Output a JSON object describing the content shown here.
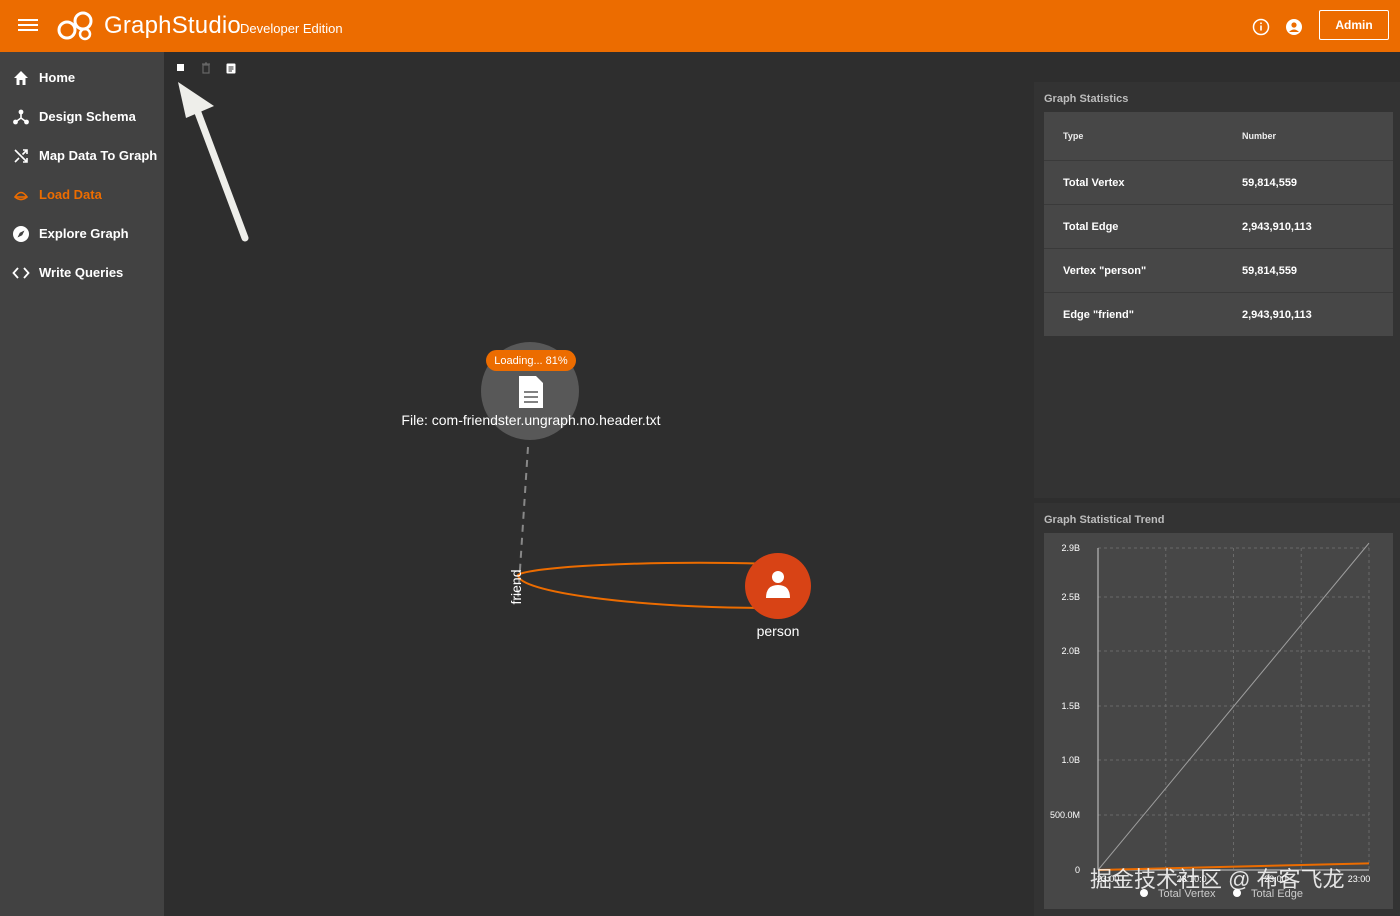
{
  "header": {
    "brand": "GraphStudio",
    "edition": "Developer Edition",
    "admin_label": "Admin"
  },
  "sidebar": {
    "items": [
      {
        "label": "Home",
        "icon": "home-icon"
      },
      {
        "label": "Design Schema",
        "icon": "schema-icon"
      },
      {
        "label": "Map Data To Graph",
        "icon": "shuffle-icon"
      },
      {
        "label": "Load Data",
        "icon": "load-icon",
        "active": true
      },
      {
        "label": "Explore Graph",
        "icon": "compass-icon"
      },
      {
        "label": "Write Queries",
        "icon": "code-icon"
      }
    ]
  },
  "canvas": {
    "toolbar": [
      "stop-icon",
      "trash-icon",
      "clipboard-icon"
    ],
    "file_node": {
      "badge": "Loading... 81%",
      "progress": 0.81,
      "label": "File: com-friendster.ungraph.no.header.txt"
    },
    "edge_label": "friend",
    "vertex_label": "person"
  },
  "stats": {
    "title": "Graph Statistics",
    "columns": [
      "Type",
      "Number"
    ],
    "rows": [
      [
        "Total Vertex",
        "59,814,559"
      ],
      [
        "Total Edge",
        "2,943,910,113"
      ],
      [
        "Vertex \"person\"",
        "59,814,559"
      ],
      [
        "Edge \"friend\"",
        "2,943,910,113"
      ]
    ]
  },
  "trend": {
    "title": "Graph Statistical Trend",
    "legend": [
      "Total Vertex",
      "Total Edge"
    ]
  },
  "chart_data": {
    "type": "line",
    "yticks": [
      "2.9B",
      "2.5B",
      "2.0B",
      "1.5B",
      "1.0B",
      "500.0M",
      "0"
    ],
    "ylim": [
      0,
      2900000000
    ],
    "x_ticks": [
      "23:00",
      "23:10:0",
      "23:00",
      "23:00"
    ],
    "series": [
      {
        "name": "Total Vertex",
        "values": [
          0,
          59814559
        ]
      },
      {
        "name": "Total Edge",
        "values": [
          0,
          2943910113
        ]
      }
    ]
  },
  "watermark": "掘金技术社区 @ 布客飞龙",
  "colors": {
    "accent": "#ec6c00",
    "vertex": "#d84315"
  }
}
